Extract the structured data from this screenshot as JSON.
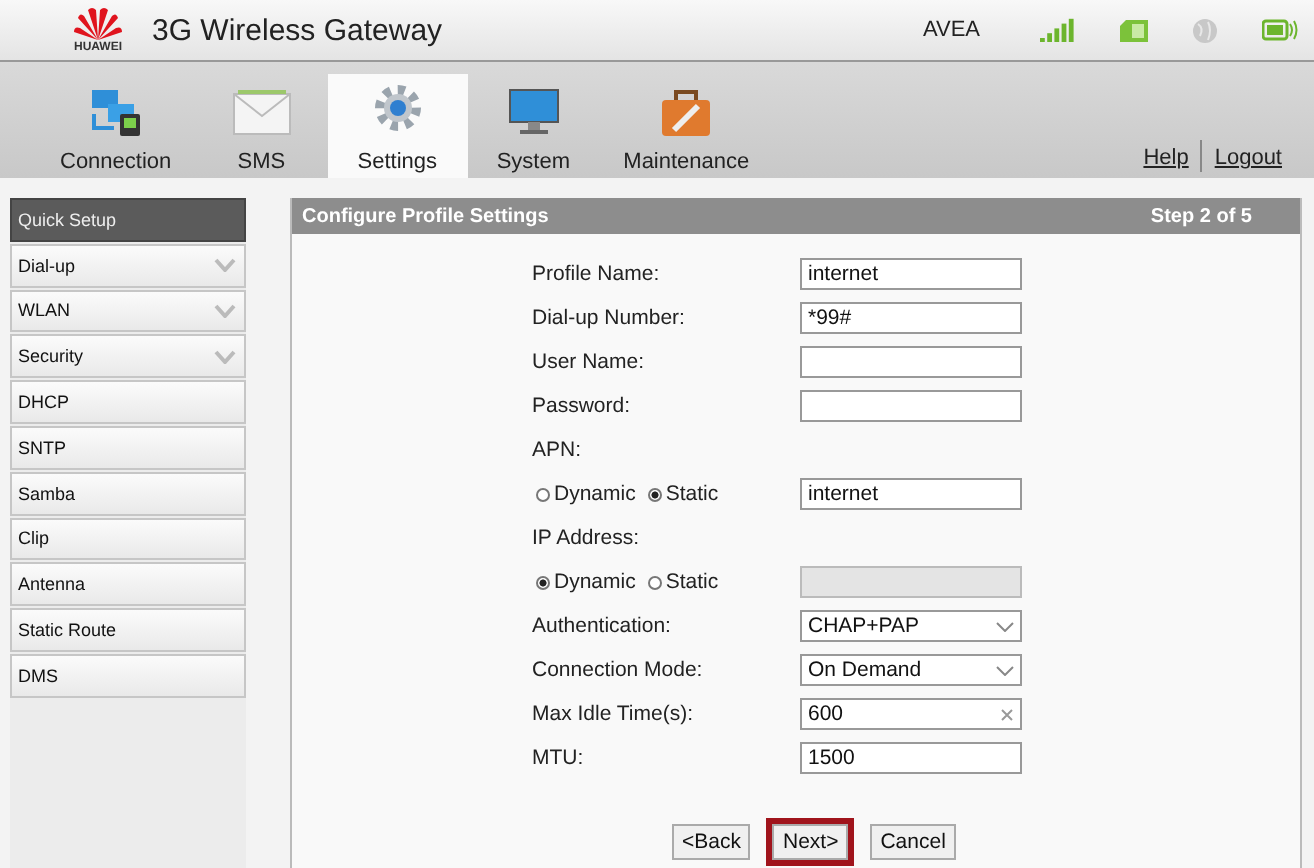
{
  "header": {
    "logo_text": "HUAWEI",
    "title": "3G Wireless Gateway",
    "operator": "AVEA"
  },
  "tabs": [
    {
      "label": "Connection",
      "selected": false
    },
    {
      "label": "SMS",
      "selected": false
    },
    {
      "label": "Settings",
      "selected": true
    },
    {
      "label": "System",
      "selected": false
    },
    {
      "label": "Maintenance",
      "selected": false
    }
  ],
  "links": [
    "Help",
    "Logout"
  ],
  "sidebar": {
    "items": [
      {
        "label": "Quick Setup",
        "selected": true,
        "expandable": false
      },
      {
        "label": "Dial-up",
        "selected": false,
        "expandable": true
      },
      {
        "label": "WLAN",
        "selected": false,
        "expandable": true
      },
      {
        "label": "Security",
        "selected": false,
        "expandable": true
      },
      {
        "label": "DHCP",
        "selected": false,
        "expandable": false
      },
      {
        "label": "SNTP",
        "selected": false,
        "expandable": false
      },
      {
        "label": "Samba",
        "selected": false,
        "expandable": false
      },
      {
        "label": "Clip",
        "selected": false,
        "expandable": false
      },
      {
        "label": "Antenna",
        "selected": false,
        "expandable": false
      },
      {
        "label": "Static Route",
        "selected": false,
        "expandable": false
      },
      {
        "label": "DMS",
        "selected": false,
        "expandable": false
      }
    ]
  },
  "panel": {
    "title": "Configure Profile Settings",
    "step": "Step 2 of 5",
    "rows": [
      {
        "kind": "text",
        "label": "Profile Name:",
        "value": "internet"
      },
      {
        "kind": "text",
        "label": "Dial-up Number:",
        "value": "*99#"
      },
      {
        "kind": "text",
        "label": "User Name:"
      },
      {
        "kind": "text",
        "label": "Password:"
      },
      {
        "kind": "heading",
        "label": "APN:"
      },
      {
        "kind": "radio",
        "options": [
          {
            "label": "Dynamic",
            "selected": false
          },
          {
            "label": "Static",
            "selected": true
          }
        ],
        "value": "internet",
        "disabled": false
      },
      {
        "kind": "heading",
        "label": "IP Address:"
      },
      {
        "kind": "radio",
        "options": [
          {
            "label": "Dynamic",
            "selected": true
          },
          {
            "label": "Static",
            "selected": false
          }
        ],
        "disabled": true
      },
      {
        "kind": "select",
        "label": "Authentication:",
        "value": "CHAP+PAP"
      },
      {
        "kind": "select",
        "label": "Connection Mode:",
        "value": "On Demand"
      },
      {
        "kind": "text",
        "label": "Max Idle Time(s):",
        "value": "600",
        "clearable": true
      },
      {
        "kind": "text",
        "label": "MTU:",
        "value": "1500"
      }
    ],
    "buttons": [
      {
        "label": "<Back",
        "highlighted": false
      },
      {
        "label": "Next>",
        "highlighted": true
      },
      {
        "label": "Cancel",
        "highlighted": false
      }
    ]
  }
}
